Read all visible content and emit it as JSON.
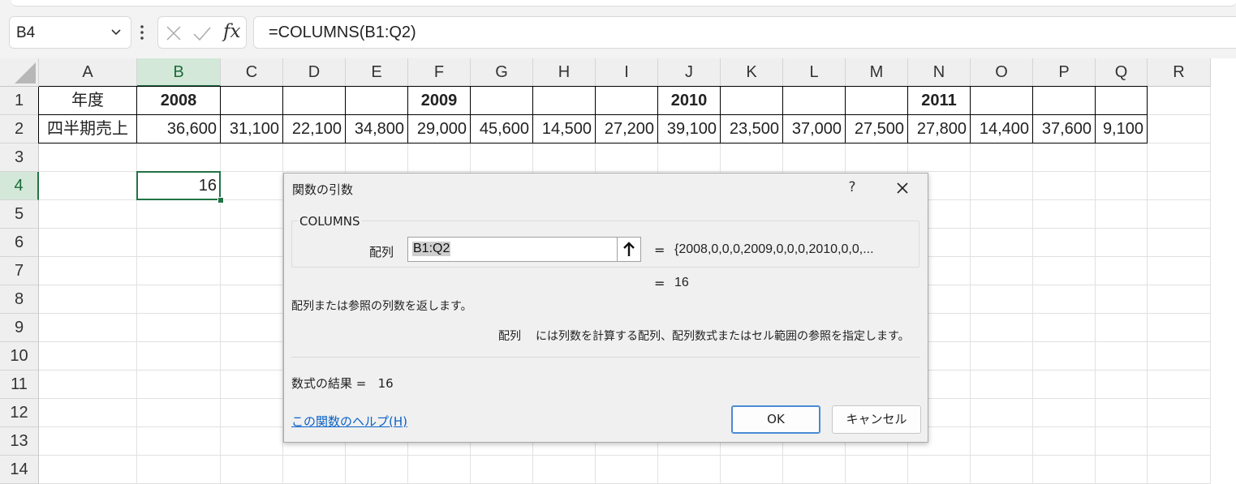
{
  "formula_bar": {
    "name_box": "B4",
    "cancel_icon": "close-icon",
    "enter_icon": "check-icon",
    "fx_label": "fx",
    "formula": "=COLUMNS(B1:Q2)"
  },
  "sheet": {
    "columns": [
      "A",
      "B",
      "C",
      "D",
      "E",
      "F",
      "G",
      "H",
      "I",
      "J",
      "K",
      "L",
      "M",
      "N",
      "O",
      "P",
      "Q",
      "R"
    ],
    "rows": [
      "1",
      "2",
      "3",
      "4",
      "5",
      "6",
      "7",
      "8",
      "9",
      "10",
      "11",
      "12",
      "13",
      "14"
    ],
    "selected_column": "B",
    "selected_row": "4",
    "row1": [
      "年度",
      "2008",
      "",
      "",
      "",
      "2009",
      "",
      "",
      "",
      "2010",
      "",
      "",
      "",
      "2011",
      "",
      "",
      ""
    ],
    "row2": [
      "四半期売上",
      "36,600",
      "31,100",
      "22,100",
      "34,800",
      "29,000",
      "45,600",
      "14,500",
      "27,200",
      "39,100",
      "23,500",
      "37,000",
      "27,500",
      "27,800",
      "14,400",
      "37,600",
      "9,100"
    ],
    "b4": "16"
  },
  "dialog": {
    "title": "関数の引数",
    "help_glyph": "?",
    "function_name": "COLUMNS",
    "arg_label": "配列",
    "arg_value": "B1:Q2",
    "eq": "=",
    "arg_preview": "{2008,0,0,0,2009,0,0,0,2010,0,0,...",
    "result_eq": "=",
    "result_preview": "16",
    "description": "配列または参照の列数を返します。",
    "arg_desc_name": "配列",
    "arg_desc": "には列数を計算する配列、配列数式またはセル範囲の参照を指定します。",
    "formula_result": "数式の結果 =   16",
    "help_link": "この関数のヘルプ(H)",
    "ok": "OK",
    "cancel": "キャンセル"
  }
}
